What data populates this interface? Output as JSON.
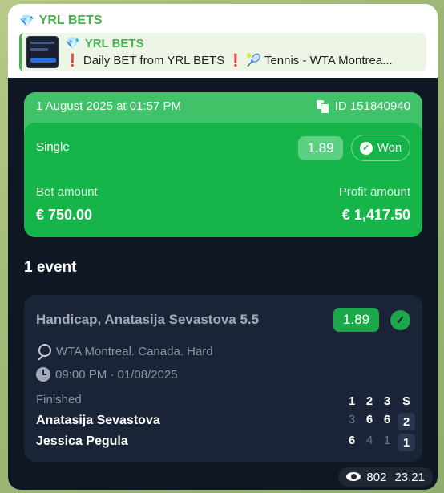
{
  "message": {
    "sender": "YRL BETS",
    "sender_icon": "gem-icon",
    "reply": {
      "title": "YRL BETS",
      "text_prefix": "Daily BET from YRL BETS",
      "text_suffix": "Tennis - WTA Montrea..."
    }
  },
  "bet": {
    "date": "1 August 2025 at 01:57 PM",
    "id_label": "ID 151840940",
    "type": "Single",
    "odds": "1.89",
    "status": "Won",
    "bet_amount_label": "Bet amount",
    "bet_amount": "€ 750.00",
    "profit_label": "Profit amount",
    "profit_amount": "€ 1,417.50"
  },
  "events_title": "1 event",
  "event": {
    "market": "Handicap, Anatasija Sevastova 5.5",
    "odds": "1.89",
    "league": "WTA Montreal. Canada. Hard",
    "time": "09:00 PM · 01/08/2025",
    "status": "Finished",
    "set_headers": [
      "1",
      "2",
      "3",
      "S"
    ],
    "players": [
      {
        "name": "Anatasija Sevastova",
        "sets": [
          "3",
          "6",
          "6"
        ],
        "total": "2"
      },
      {
        "name": "Jessica Pegula",
        "sets": [
          "6",
          "4",
          "1"
        ],
        "total": "1"
      }
    ]
  },
  "footer": {
    "views": "802",
    "time": "23:21"
  },
  "colors": {
    "accent_green": "#15b54a",
    "dark_bg": "#0f1624",
    "sender_green": "#4caf50"
  }
}
